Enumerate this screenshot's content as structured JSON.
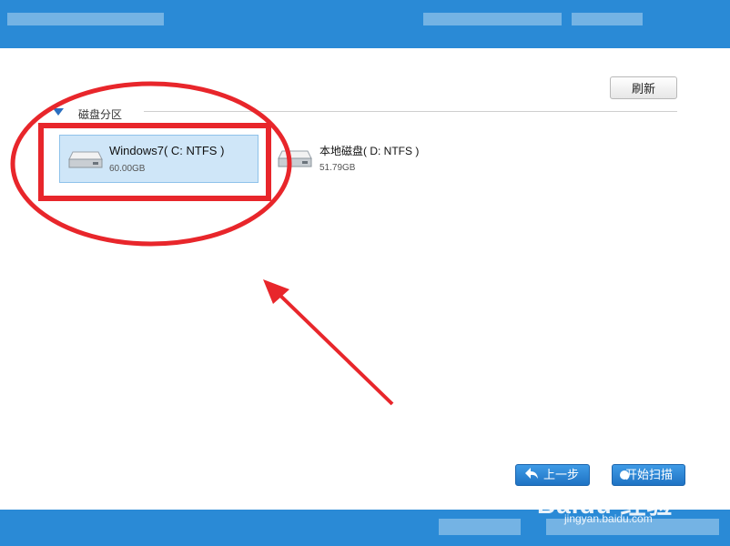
{
  "toolbar": {
    "refresh_label": "刷新"
  },
  "section": {
    "title": "磁盘分区"
  },
  "disks": [
    {
      "name": "Windows7( C: NTFS )",
      "size": "60.00GB",
      "selected": true
    },
    {
      "name": "本地磁盘( D: NTFS )",
      "size": "51.79GB",
      "selected": false
    }
  ],
  "footer": {
    "back_label": "上一步",
    "start_label": "开始扫描"
  },
  "watermark": {
    "brand": "Baidu 经验",
    "url": "jingyan.baidu.com"
  },
  "colors": {
    "titlebar": "#2a8ad6",
    "selection": "#cfe6f8",
    "annotation_red": "#e8262b",
    "button_blue": "#2a80d0"
  },
  "icons": [
    "drive-icon",
    "back-arrow-icon",
    "scan-icon",
    "triangle-down-icon"
  ]
}
